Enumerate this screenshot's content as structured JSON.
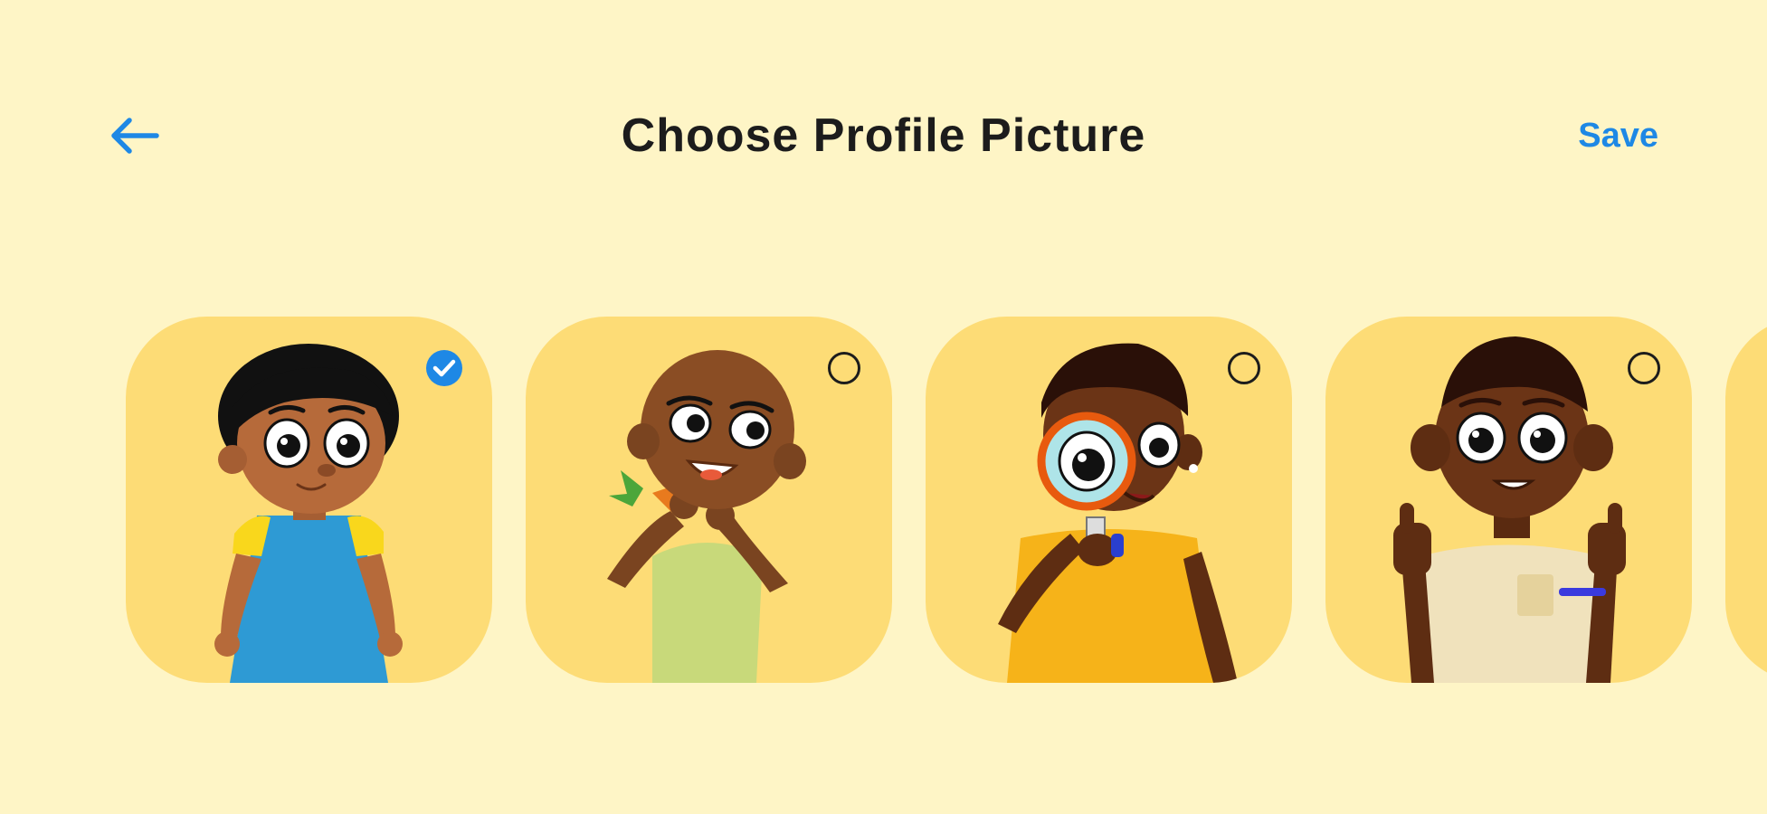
{
  "header": {
    "title": "Choose Profile Picture",
    "save_label": "Save",
    "back_icon": "arrow-left-icon"
  },
  "colors": {
    "background": "#FEF5C6",
    "card": "#FDDC76",
    "accent": "#1E88E5",
    "title": "#1C1C1C"
  },
  "avatars": [
    {
      "name": "girl with blue apron",
      "selected": true
    },
    {
      "name": "boy holding carrot",
      "selected": false
    },
    {
      "name": "boy with magnifying glass",
      "selected": false
    },
    {
      "name": "boy thumbs up",
      "selected": false
    },
    {
      "name": "partially visible avatar",
      "selected": false
    }
  ]
}
